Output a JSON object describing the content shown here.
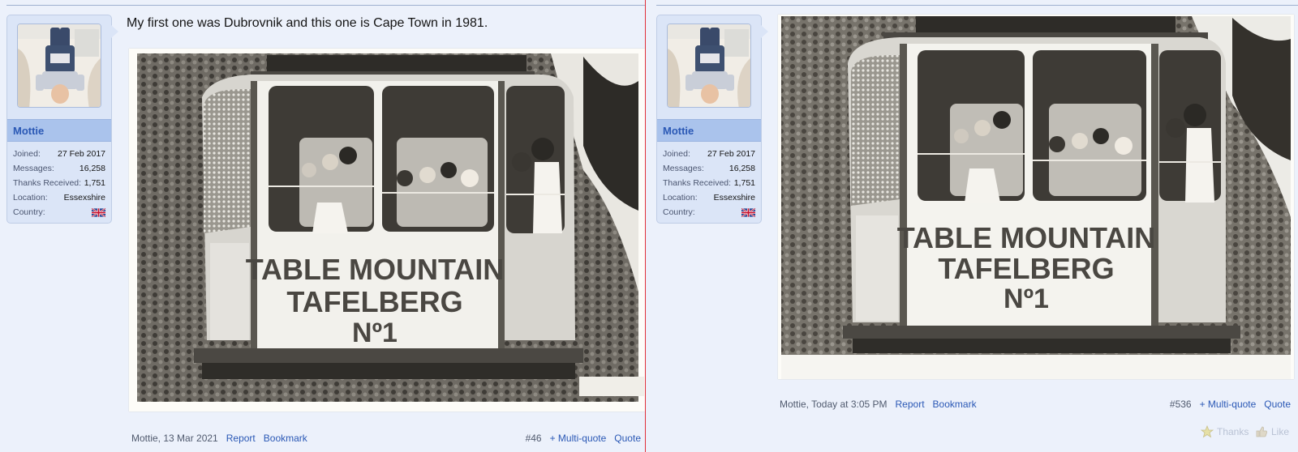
{
  "posts": [
    {
      "user": {
        "name": "Mottie",
        "stats": [
          {
            "label": "Joined:",
            "value": "27 Feb 2017"
          },
          {
            "label": "Messages:",
            "value": "16,258"
          },
          {
            "label": "Thanks Received:",
            "value": "1,751"
          },
          {
            "label": "Location:",
            "value": "Essexshire"
          },
          {
            "label": "Country:",
            "value": "",
            "icon": "uk-flag-icon"
          }
        ]
      },
      "text": "My first one was Dubrovnik and this one is Cape Town in 1981.",
      "photo": {
        "sign_line1": "TABLE MOUNTAIN",
        "sign_line2": "TAFELBERG",
        "sign_line3": "Nº1"
      },
      "footer": {
        "meta": "Mottie, 13 Mar 2021",
        "report": "Report",
        "bookmark": "Bookmark",
        "number": "#46",
        "multiquote": "+ Multi-quote",
        "quote": "Quote"
      }
    },
    {
      "user": {
        "name": "Mottie",
        "stats": [
          {
            "label": "Joined:",
            "value": "27 Feb 2017"
          },
          {
            "label": "Messages:",
            "value": "16,258"
          },
          {
            "label": "Thanks Received:",
            "value": "1,751"
          },
          {
            "label": "Location:",
            "value": "Essexshire"
          },
          {
            "label": "Country:",
            "value": "",
            "icon": "uk-flag-icon"
          }
        ]
      },
      "photo": {
        "sign_line1": "TABLE MOUNTAIN",
        "sign_line2": "TAFELBERG",
        "sign_line3": "Nº1"
      },
      "footer": {
        "meta": "Mottie, Today at 3:05 PM",
        "report": "Report",
        "bookmark": "Bookmark",
        "number": "#536",
        "multiquote": "+ Multi-quote",
        "quote": "Quote"
      },
      "reactions": {
        "thanks": "Thanks",
        "like": "Like"
      }
    }
  ],
  "colors": {
    "accent": "#2a58b5",
    "card": "#dbe5f7",
    "name_bar": "#aac3ec",
    "divider": "#e0303a"
  }
}
